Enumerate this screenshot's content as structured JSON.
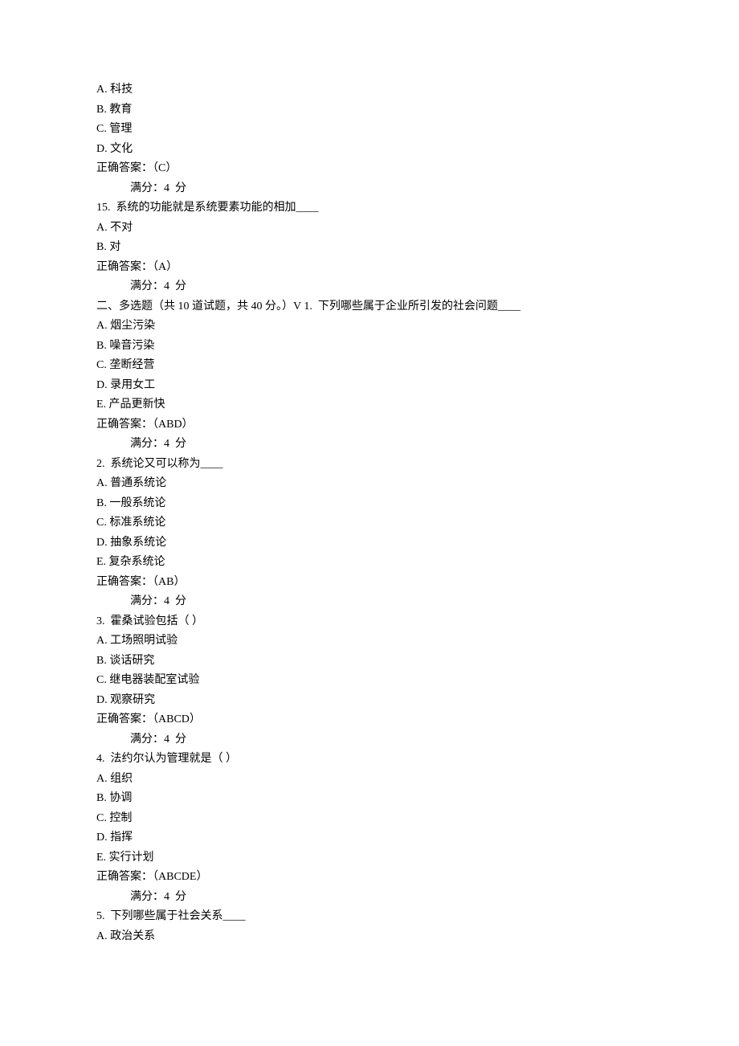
{
  "q14_tail": {
    "optA": "A. 科技",
    "optB": "B. 教育",
    "optC": "C. 管理",
    "optD": "D. 文化",
    "answer": "正确答案：（C）",
    "score": "满分：4  分"
  },
  "q15": {
    "stem": "15.  系统的功能就是系统要素功能的相加____",
    "optA": "A. 不对",
    "optB": "B. 对",
    "answer": "正确答案：（A）",
    "score": "满分：4  分"
  },
  "section2_header": "二、多选题（共 10 道试题，共 40 分。）V 1.  下列哪些属于企业所引发的社会问题____",
  "m1": {
    "optA": "A. 烟尘污染",
    "optB": "B. 噪音污染",
    "optC": "C. 垄断经营",
    "optD": "D. 录用女工",
    "optE": "E. 产品更新快",
    "answer": "正确答案：（ABD）",
    "score": "满分：4  分"
  },
  "m2": {
    "stem": "2.  系统论又可以称为____",
    "optA": "A. 普通系统论",
    "optB": "B. 一般系统论",
    "optC": "C. 标准系统论",
    "optD": "D. 抽象系统论",
    "optE": "E. 复杂系统论",
    "answer": "正确答案：（AB）",
    "score": "满分：4  分"
  },
  "m3": {
    "stem": "3.  霍桑试验包括（ ）",
    "optA": "A. 工场照明试验",
    "optB": "B. 谈话研究",
    "optC": "C. 继电器装配室试验",
    "optD": "D. 观察研究",
    "answer": "正确答案：（ABCD）",
    "score": "满分：4  分"
  },
  "m4": {
    "stem": "4.  法约尔认为管理就是（ ）",
    "optA": "A. 组织",
    "optB": "B. 协调",
    "optC": "C. 控制",
    "optD": "D. 指挥",
    "optE": "E. 实行计划",
    "answer": "正确答案：（ABCDE）",
    "score": "满分：4  分"
  },
  "m5": {
    "stem": "5.  下列哪些属于社会关系____",
    "optA": "A. 政治关系"
  }
}
